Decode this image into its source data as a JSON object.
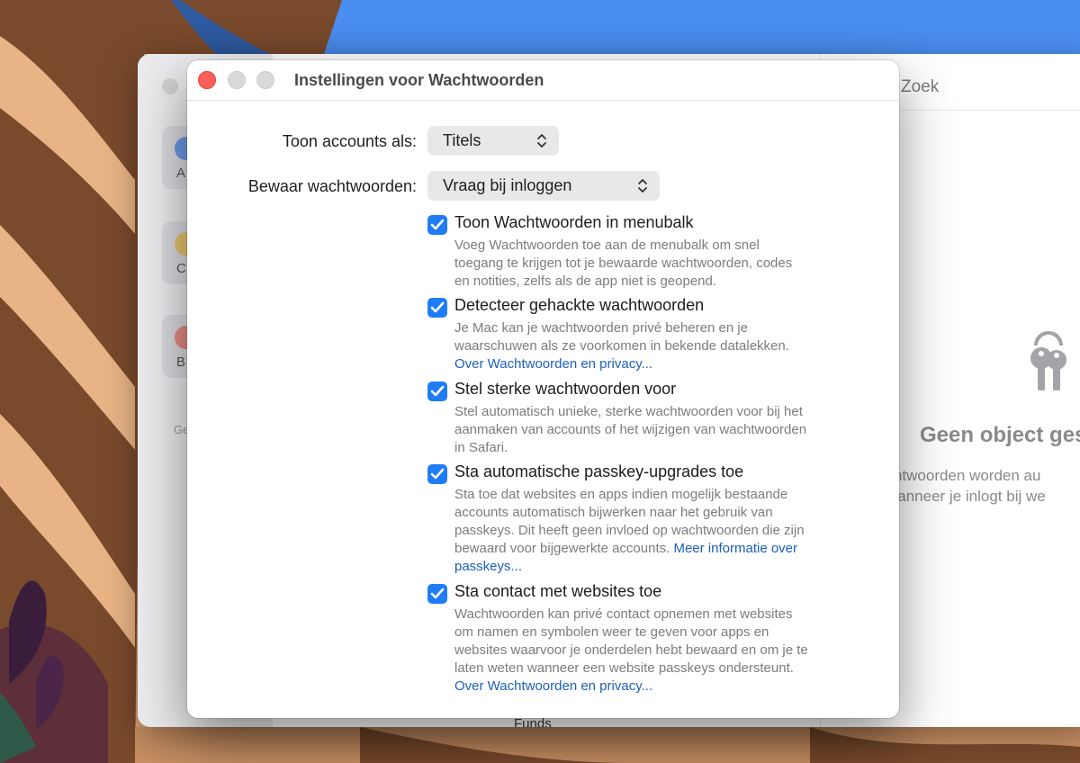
{
  "background_app": {
    "search_placeholder": "Zoek",
    "sidebar_categories": [
      {
        "letter": "A",
        "color": "#6d9ae8"
      },
      {
        "letter": "C",
        "color": "#e8c66d"
      },
      {
        "letter": "B",
        "color": "#e88a84"
      }
    ],
    "sidebar_section_label": "Ge",
    "empty_state_title": "Geen object ges",
    "empty_state_lines": [
      "achtwoorden worden au",
      "wanneer je inlogt bij we"
    ],
    "bottom_item_label": "Funds"
  },
  "settings": {
    "title": "Instellingen voor Wachtwoorden",
    "show_accounts": {
      "label": "Toon accounts als:",
      "value": "Titels"
    },
    "save_passwords": {
      "label": "Bewaar wachtwoorden:",
      "value": "Vraag bij inloggen"
    },
    "options": [
      {
        "title": "Toon Wachtwoorden in menubalk",
        "checked": true,
        "lines": [
          "Voeg Wachtwoorden toe aan de menubalk om snel",
          "toegang te krijgen tot je bewaarde wachtwoorden, codes",
          "en notities, zelfs als de app niet is geopend."
        ]
      },
      {
        "title": "Detecteer gehackte wachtwoorden",
        "checked": true,
        "lines": [
          "Je Mac kan je wachtwoorden privé beheren en je",
          "waarschuwen als ze voorkomen in bekende datalekken."
        ],
        "link": "Over Wachtwoorden en privacy..."
      },
      {
        "title": "Stel sterke wachtwoorden voor",
        "checked": true,
        "lines": [
          "Stel automatisch unieke, sterke wachtwoorden voor bij het",
          "aanmaken van accounts of het wijzigen van wachtwoorden",
          "in Safari."
        ]
      },
      {
        "title": "Sta automatische passkey-upgrades toe",
        "checked": true,
        "lines": [
          "Sta toe dat websites en apps indien mogelijk bestaande",
          "accounts automatisch bijwerken naar het gebruik van",
          "passkeys. Dit heeft geen invloed op wachtwoorden die zijn"
        ],
        "line4_text": "bewaard voor bijgewerkte accounts.",
        "line4_link": "Meer informatie over",
        "link": "passkeys..."
      },
      {
        "title": "Sta contact met websites toe",
        "checked": true,
        "lines": [
          "Wachtwoorden kan privé contact opnemen met websites",
          "om namen en symbolen weer te geven voor apps en",
          "websites waarvoor je onderdelen hebt bewaard en om je te",
          "laten weten wanneer een website passkeys ondersteunt."
        ],
        "link": "Over Wachtwoorden en privacy..."
      }
    ]
  },
  "colors": {
    "accent": "#1f7cf6",
    "link": "#1c5fbf",
    "close_light": "#fe5f57"
  }
}
